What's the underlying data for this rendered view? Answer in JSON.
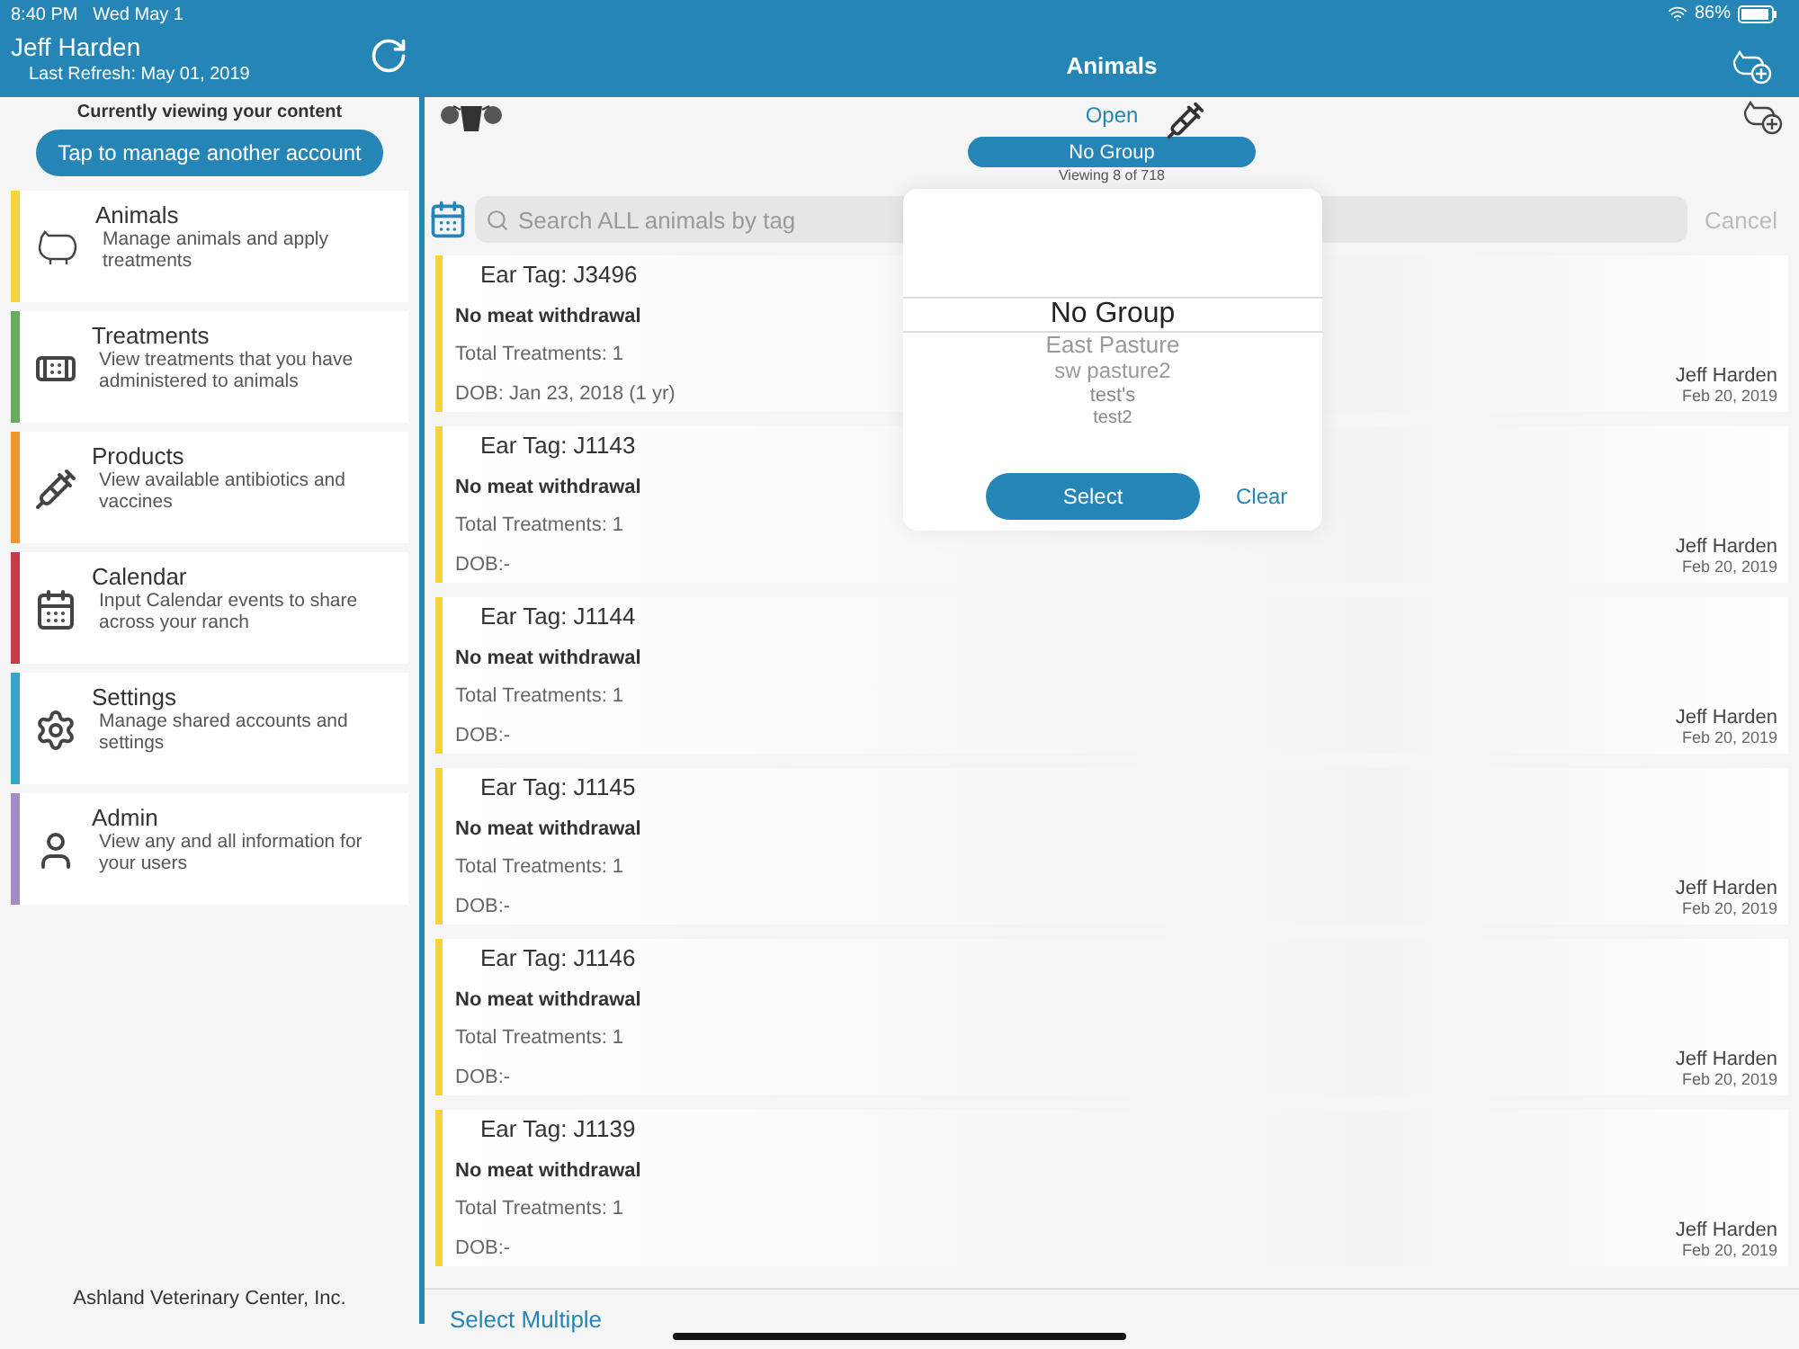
{
  "status_bar": {
    "time": "8:40 PM",
    "date": "Wed May 1",
    "battery": "86%"
  },
  "user": {
    "name": "Jeff Harden",
    "last_refresh": "Last Refresh: May 01, 2019"
  },
  "title": "Animals",
  "sidebar": {
    "notice": "Currently viewing your content",
    "manage_button": "Tap to manage another account",
    "items": [
      {
        "kind": "animal",
        "title": "Animals",
        "description": "Manage animals and apply treatments",
        "color": "#f5d33c"
      },
      {
        "kind": "treatment",
        "title": "Treatments",
        "description": "View treatments that you have administered to animals",
        "color": "#6aaa5c"
      },
      {
        "kind": "product",
        "title": "Products",
        "description": "View available antibiotics and vaccines",
        "color": "#f0952a"
      },
      {
        "kind": "calendar",
        "title": "Calendar",
        "description": "Input Calendar events to share across your ranch",
        "color": "#c8394a"
      },
      {
        "kind": "settings",
        "title": "Settings",
        "description": "Manage shared accounts and settings",
        "color": "#35a7c4"
      },
      {
        "kind": "admin",
        "title": "Admin",
        "description": "View any and all information for your users",
        "color": "#a38cc4"
      }
    ],
    "footer": "Ashland Veterinary Center, Inc."
  },
  "filter": {
    "status": "Open",
    "group": "No Group",
    "viewing": "Viewing",
    "count": "8 of 718"
  },
  "search": {
    "placeholder": "Search ALL animals by tag",
    "cancel": "Cancel"
  },
  "animals": [
    {
      "tag": "Ear Tag: J3496",
      "withdrawal": "No meat withdrawal",
      "treatments": "Total Treatments: 1",
      "dob": "DOB: Jan 23, 2018 (1 yr)",
      "owner": "Jeff Harden",
      "date": "Feb 20, 2019"
    },
    {
      "tag": "Ear Tag: J1143",
      "withdrawal": "No meat withdrawal",
      "treatments": "Total Treatments: 1",
      "dob": "DOB:-",
      "owner": "Jeff Harden",
      "date": "Feb 20, 2019"
    },
    {
      "tag": "Ear Tag: J1144",
      "withdrawal": "No meat withdrawal",
      "treatments": "Total Treatments: 1",
      "dob": "DOB:-",
      "owner": "Jeff Harden",
      "date": "Feb 20, 2019"
    },
    {
      "tag": "Ear Tag: J1145",
      "withdrawal": "No meat withdrawal",
      "treatments": "Total Treatments: 1",
      "dob": "DOB:-",
      "owner": "Jeff Harden",
      "date": "Feb 20, 2019"
    },
    {
      "tag": "Ear Tag: J1146",
      "withdrawal": "No meat withdrawal",
      "treatments": "Total Treatments: 1",
      "dob": "DOB:-",
      "owner": "Jeff Harden",
      "date": "Feb 20, 2019"
    },
    {
      "tag": "Ear Tag: J1139",
      "withdrawal": "No meat withdrawal",
      "treatments": "Total Treatments: 1",
      "dob": "DOB:-",
      "owner": "Jeff Harden",
      "date": "Feb 20, 2019"
    }
  ],
  "select_multiple": "Select Multiple",
  "picker": {
    "options": [
      {
        "label": "No Group",
        "selected": true
      },
      {
        "label": "East Pasture",
        "selected": false
      },
      {
        "label": "sw pasture2",
        "selected": false
      },
      {
        "label": "test's",
        "selected": false
      },
      {
        "label": "test2",
        "selected": false
      }
    ],
    "select": "Select",
    "clear": "Clear"
  }
}
